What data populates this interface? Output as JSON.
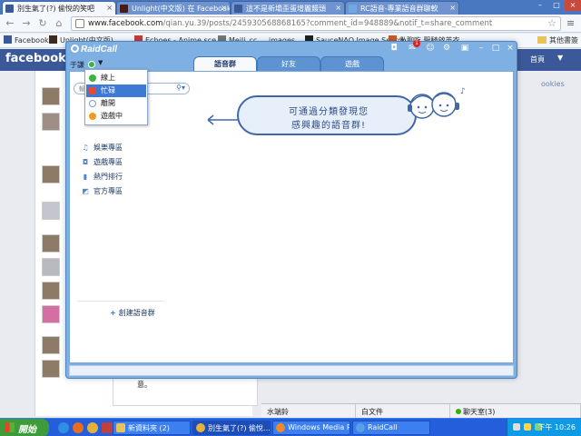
{
  "browser": {
    "tabs": [
      {
        "title": "別生氣了(?) 偷悅的笑吧",
        "active": true
      },
      {
        "title": "Unlight(中文版) 在 Facebook",
        "active": false
      },
      {
        "title": "這不是新塌歪蛋增麗饅頭",
        "active": false
      },
      {
        "title": "RC語音-專業語音群聊軟",
        "active": false
      }
    ],
    "url_prefix": "www.facebook.com",
    "url_rest": "/qian.yu.39/posts/245930568868165?comment_id=948889&notif_t=share_comment",
    "bookmarks": [
      "Facebook",
      "Unlight(中文版)",
      "Echoes - Anime sce",
      "Meili_cc ... images",
      "SauceNAO Image Search",
      "私聊吃 聖騎啟英衣..."
    ],
    "other_bookmarks": "其他書簽"
  },
  "facebook": {
    "logo": "facebook",
    "home": "首頁",
    "cookies": "ookies",
    "comment_text": "意。",
    "chatbar": {
      "contact1": "水端鈴",
      "contact2": "白文件",
      "chat": "聊天室(3)"
    }
  },
  "raidcall": {
    "logo": "RaidCall",
    "user": "于謙",
    "notification_count": "1",
    "tabs": [
      "語音群",
      "好友",
      "遊戲"
    ],
    "search_placeholder": "輸入",
    "status_menu": [
      "線上",
      "忙碌",
      "離開",
      "遊戲中"
    ],
    "selected_status": "忙碌",
    "categories": [
      "娛樂專區",
      "遊戲專區",
      "熱門排行",
      "官方專區"
    ],
    "create_group": "創建語音群",
    "bubble_line1": "可通過分類發現您",
    "bubble_line2": "感興趣的語音群!"
  },
  "taskbar": {
    "start": "開始",
    "items": [
      "新資料夾 (2)",
      "別生氣了(?) 偷悅...",
      "Windows Media Pl...",
      "RaidCall"
    ],
    "clock": "下午 10:26"
  }
}
